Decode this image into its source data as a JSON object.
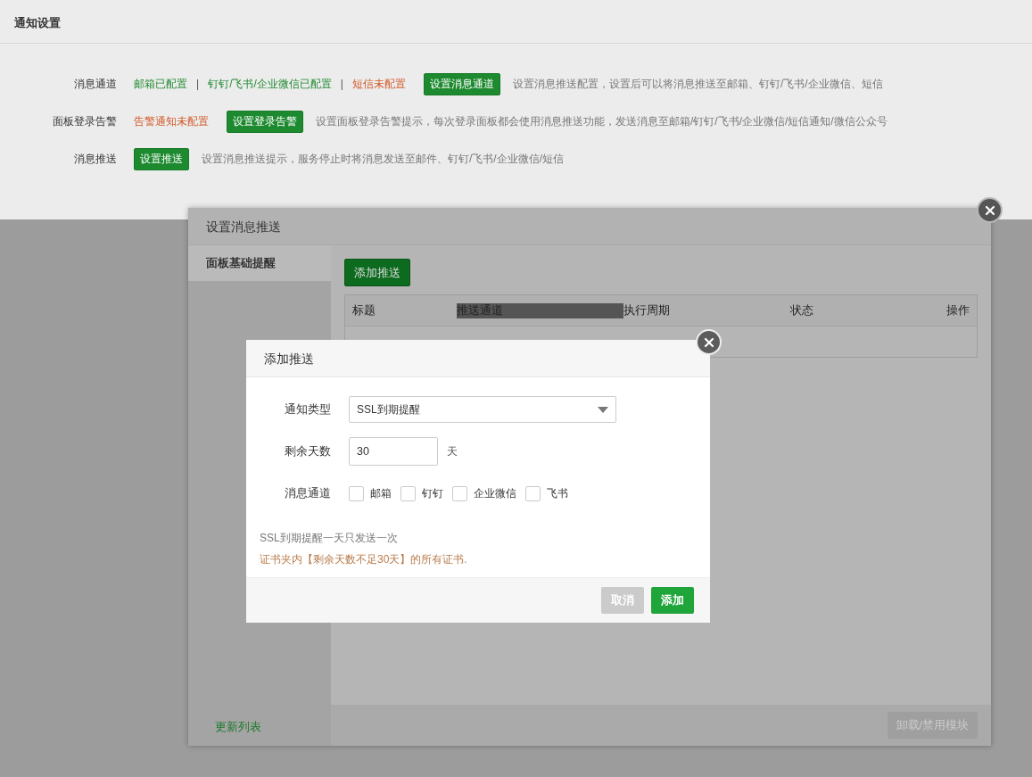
{
  "page": {
    "title": "通知设置"
  },
  "settings": [
    {
      "label": "消息通道",
      "separator": "|",
      "statuses": [
        {
          "text": "邮箱已配置",
          "configured": true
        },
        {
          "text": "钉钉/飞书/企业微信已配置",
          "configured": true
        },
        {
          "text": "短信未配置",
          "configured": false
        }
      ],
      "button": "设置消息通道",
      "description": "设置消息推送配置，设置后可以将消息推送至邮箱、钉钉/飞书/企业微信、短信"
    },
    {
      "label": "面板登录告警",
      "statuses": [
        {
          "text": "告警通知未配置",
          "configured": false
        }
      ],
      "button": "设置登录告警",
      "description": "设置面板登录告警提示，每次登录面板都会使用消息推送功能，发送消息至邮箱/钉钉/飞书/企业微信/短信通知/微信公众号"
    },
    {
      "label": "消息推送",
      "button": "设置推送",
      "description": "设置消息推送提示，服务停止时将消息发送至邮件、钉钉/飞书/企业微信/短信"
    }
  ],
  "push_dialog": {
    "title": "设置消息推送",
    "sidebar": [
      {
        "label": "面板基础提醒",
        "selected": true
      }
    ],
    "add_button": "添加推送",
    "table": {
      "columns": [
        "标题",
        "推送通道",
        "执行周期",
        "状态",
        "操作"
      ]
    },
    "footer_link": "更新列表",
    "footer_button": "卸载/禁用模块"
  },
  "add_dialog": {
    "title": "添加推送",
    "fields": [
      {
        "kind": "select",
        "label": "通知类型",
        "value": "SSL到期提醒"
      },
      {
        "kind": "number",
        "label": "剩余天数",
        "value": "30",
        "unit": "天"
      },
      {
        "kind": "checkboxes",
        "label": "消息通道",
        "options": [
          {
            "label": "邮箱",
            "checked": false
          },
          {
            "label": "钉钉",
            "checked": false
          },
          {
            "label": "企业微信",
            "checked": false
          },
          {
            "label": "飞书",
            "checked": false
          }
        ]
      }
    ],
    "notes": [
      {
        "kind": "hint",
        "text": "SSL到期提醒一天只发送一次"
      },
      {
        "kind": "warning",
        "text": "证书夹内【剩余天数不足30天】的所有证书."
      }
    ],
    "buttons": [
      {
        "kind": "cancel",
        "label": "取消"
      },
      {
        "kind": "primary",
        "label": "添加"
      }
    ]
  }
}
